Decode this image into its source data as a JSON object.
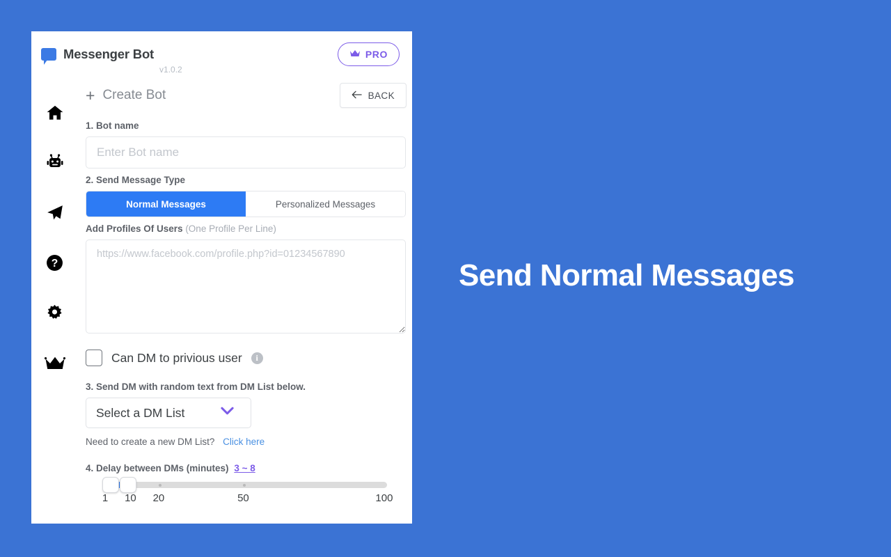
{
  "theme": {
    "page_background": "#3b73d4",
    "accent_blue": "#2d7bf4",
    "accent_purple": "#7c5ce8",
    "link_blue": "#4a90e2"
  },
  "brand": {
    "name": "Messenger Bot",
    "version": "v1.0.2",
    "logo_icon": "speech-bubble-icon",
    "pro_badge": {
      "label": "PRO",
      "icon": "crown-icon"
    }
  },
  "sidebar": {
    "items": [
      {
        "icon": "home-icon",
        "name": "home"
      },
      {
        "icon": "robot-icon",
        "name": "bots"
      },
      {
        "icon": "paper-plane-icon",
        "name": "send"
      },
      {
        "icon": "question-circle-icon",
        "name": "help"
      },
      {
        "icon": "gear-icon",
        "name": "settings"
      },
      {
        "icon": "crown-icon",
        "name": "premium"
      }
    ]
  },
  "main": {
    "page_title": "Create Bot",
    "page_title_icon": "plus-icon",
    "back_button": {
      "label": "BACK",
      "icon": "arrow-left-icon"
    },
    "bot_name": {
      "label": "1. Bot name",
      "value": "",
      "placeholder": "Enter Bot name"
    },
    "message_type": {
      "label": "2. Send Message Type",
      "tabs": [
        {
          "label": "Normal Messages",
          "active": true
        },
        {
          "label": "Personalized Messages",
          "active": false
        }
      ]
    },
    "profiles": {
      "label": "Add Profiles Of Users",
      "label_hint": "(One Profile Per Line)",
      "value": "",
      "placeholder": "https://www.facebook.com/profile.php?id=01234567890"
    },
    "dm_previous": {
      "label": "Can DM to privious user",
      "checked": false,
      "info_icon": "info-circle-icon"
    },
    "dm_list": {
      "label": "3. Send DM with random text from DM List below.",
      "selected": "Select a DM List",
      "options": [
        "Select a DM List"
      ],
      "chevron_icon": "chevron-down-icon",
      "help_text": "Need to create a new DM List?",
      "help_link": "Click here"
    },
    "delay": {
      "label": "4. Delay between DMs (minutes)",
      "range_text": "3 ~ 8",
      "min_value": 3,
      "max_value": 8,
      "scale": [
        "1",
        "10",
        "20",
        "50",
        "100"
      ],
      "scale_positions": [
        0,
        9,
        19,
        49,
        100
      ]
    }
  },
  "headline": {
    "text": "Send Normal Messages"
  }
}
